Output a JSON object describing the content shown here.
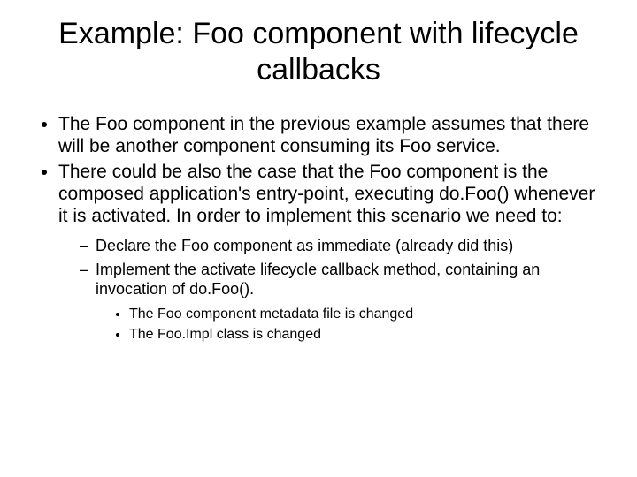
{
  "title": "Example: Foo component with lifecycle callbacks",
  "bullets": {
    "b1": "The Foo component in the previous example assumes that there will be another component consuming its Foo service.",
    "b2": "There could be also the case that the Foo component is the composed application's entry-point, executing do.Foo() whenever it is activated. In order to implement this scenario we need to:",
    "sub1": "Declare the Foo component as immediate (already did this)",
    "sub2": "Implement the activate lifecycle callback method, containing an invocation of do.Foo().",
    "ssub1": "The Foo component metadata file is changed",
    "ssub2": "The Foo.Impl class is changed"
  }
}
